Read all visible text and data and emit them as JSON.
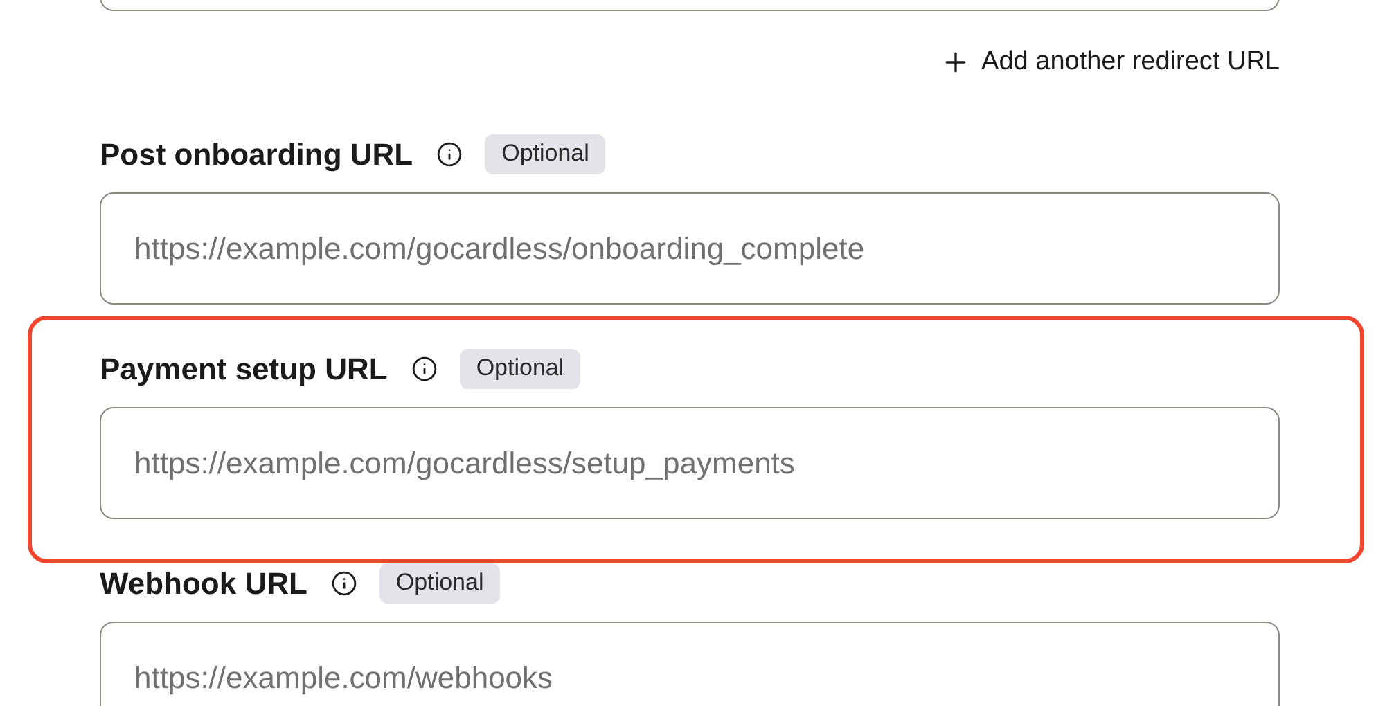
{
  "add_link": {
    "label": "Add another redirect URL"
  },
  "fields": [
    {
      "label": "Post onboarding URL",
      "badge": "Optional",
      "placeholder": "https://example.com/gocardless/onboarding_complete",
      "highlighted": false
    },
    {
      "label": "Payment setup URL",
      "badge": "Optional",
      "placeholder": "https://example.com/gocardless/setup_payments",
      "highlighted": true
    },
    {
      "label": "Webhook URL",
      "badge": "Optional",
      "placeholder": "https://example.com/webhooks",
      "highlighted": false
    }
  ]
}
